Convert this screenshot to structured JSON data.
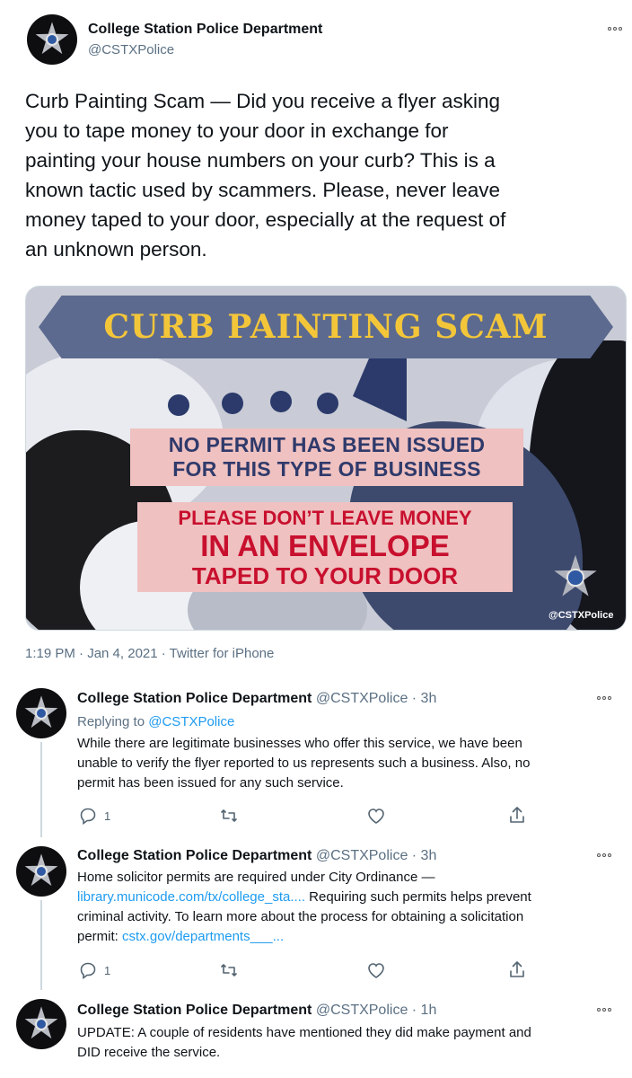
{
  "main_tweet": {
    "author_name": "College Station Police Department",
    "author_handle": "@CSTXPolice",
    "text_lines": [
      "Curb Painting Scam — Did you receive a flyer asking",
      "you to tape money to your door in exchange for",
      "painting your house numbers on your curb? This is a",
      "known tactic used by scammers. Please, never leave",
      "money taped to your door, especially at the request of",
      "an unknown person."
    ],
    "image": {
      "banner": "CURB PAINTING SCAM",
      "box1_lines": [
        "NO PERMIT HAS BEEN ISSUED",
        "FOR THIS TYPE OF BUSINESS"
      ],
      "box2_lines": [
        "PLEASE DON’T LEAVE MONEY",
        "IN AN ENVELOPE",
        "TAPED TO YOUR DOOR"
      ],
      "watermark": "@CSTXPolice"
    },
    "meta": "1:19 PM · Jan 4, 2021 · Twitter for iPhone"
  },
  "replies": [
    {
      "author_name": "College Station Police Department",
      "author_handle": "@CSTXPolice · 3h",
      "replying_prefix": "Replying to ",
      "replying_to": "@CSTXPolice",
      "lines": [
        "While there are legitimate businesses who offer this service, we have been",
        "unable to verify the flyer reported to us represents such a business. Also, no",
        "permit has been issued for any such service."
      ],
      "reply_count": "1"
    },
    {
      "author_name": "College Station Police Department",
      "author_handle": "@CSTXPolice · 3h",
      "line1": "Home solicitor permits are required under City Ordinance —",
      "line2_link": "library.municode.com/tx/college_sta....",
      "line2_rest": " Requiring such permits helps prevent",
      "line3": "criminal activity. To learn more about the process for obtaining a solicitation",
      "line4_prefix": "permit: ",
      "line4_link": "cstx.gov/departments___...",
      "reply_count": "1"
    },
    {
      "author_name": "College Station Police Department",
      "author_handle": "@CSTXPolice · 1h",
      "lines": [
        "UPDATE: A couple of residents have mentioned they did make payment and",
        "DID receive the service."
      ]
    }
  ],
  "icons": {
    "more": "more-options-icon",
    "reply": "reply-icon",
    "retweet": "retweet-icon",
    "like": "like-icon",
    "share": "share-icon"
  },
  "colors": {
    "link": "#1d9bf0",
    "banner_bg": "#5c6a8f",
    "banner_text": "#f3c63a",
    "box_bg": "#efc1c0",
    "box1_text": "#2f3a6b",
    "box2_text": "#c8102e"
  }
}
